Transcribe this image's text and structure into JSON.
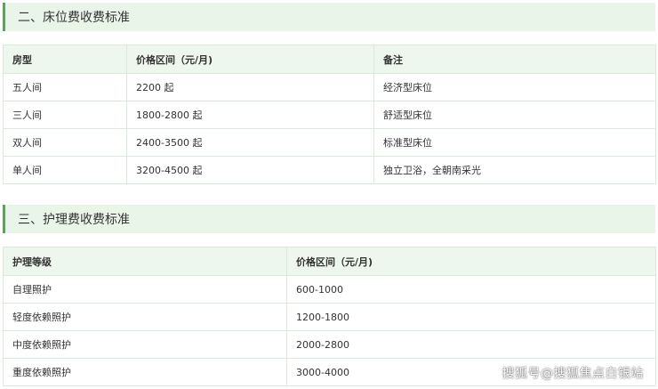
{
  "section1": {
    "title": "二、床位费收费标准",
    "headers": [
      "房型",
      "价格区间（元/月)",
      "备注"
    ],
    "rows": [
      [
        "五人间",
        "2200 起",
        "经济型床位"
      ],
      [
        "三人间",
        "1800-2800 起",
        "舒适型床位"
      ],
      [
        "双人间",
        "2400-3500 起",
        "标准型床位"
      ],
      [
        "单人间",
        "3200-4500 起",
        "独立卫浴，全朝南采光"
      ]
    ]
  },
  "section2": {
    "title": "三、护理费收费标准",
    "headers": [
      "护理等级",
      "价格区间（元/月)"
    ],
    "rows": [
      [
        "自理照护",
        "600-1000"
      ],
      [
        "轻度依赖照护",
        "1200-1800"
      ],
      [
        "中度依赖照护",
        "2000-2800"
      ],
      [
        "重度依赖照护",
        "3000-4000"
      ]
    ]
  },
  "watermark": "搜狐号@搜狐焦点白银站"
}
